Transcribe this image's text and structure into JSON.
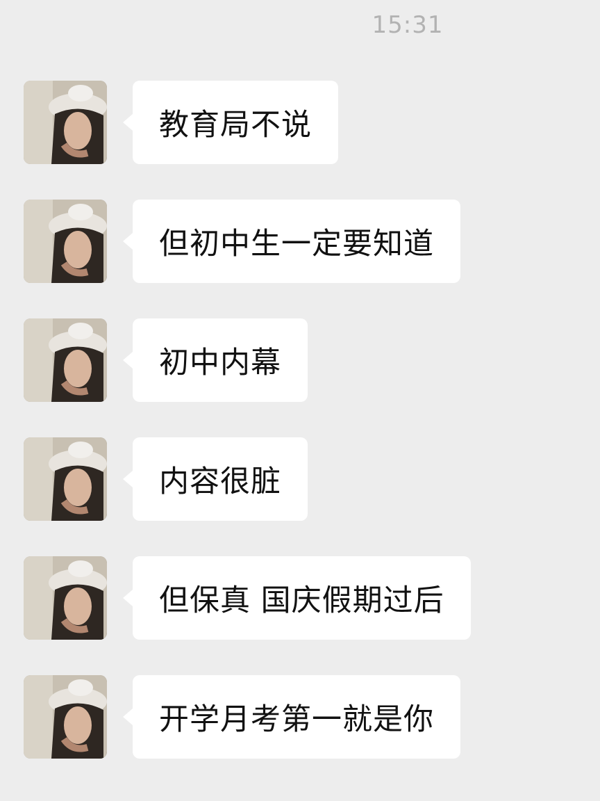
{
  "chat": {
    "timestamp": "15:31",
    "messages": [
      {
        "text": "教育局不说",
        "avatar": "user-avatar"
      },
      {
        "text": "但初中生一定要知道",
        "avatar": "user-avatar"
      },
      {
        "text": "初中内幕",
        "avatar": "user-avatar"
      },
      {
        "text": "内容很脏",
        "avatar": "user-avatar"
      },
      {
        "text": "但保真 国庆假期过后",
        "avatar": "user-avatar"
      },
      {
        "text": "开学月考第一就是你",
        "avatar": "user-avatar"
      }
    ]
  },
  "colors": {
    "background": "#ededed",
    "bubble": "#ffffff",
    "text": "#111111",
    "timestamp": "#b2b2b2"
  }
}
